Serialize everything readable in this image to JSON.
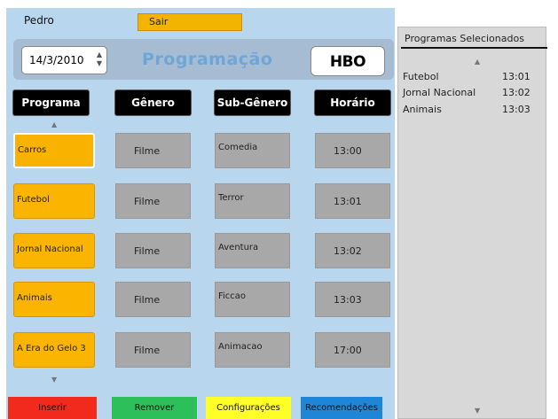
{
  "user": {
    "name": "Pedro",
    "logout_label": "Sair"
  },
  "date": {
    "value": "14/3/2010",
    "spinner_up": "▲",
    "spinner_down": "▼"
  },
  "title": "Programação",
  "channel_logo": "HBO",
  "columns": [
    "Programa",
    "Gênero",
    "Sub-Gênero",
    "Horário"
  ],
  "arrows": {
    "up": "▲",
    "down": "▼"
  },
  "programs": [
    {
      "name": "Carros",
      "genre": "Filme",
      "subgenre": "Comedia",
      "time": "13:00",
      "selected": true
    },
    {
      "name": "Futebol",
      "genre": "Filme",
      "subgenre": "Terror",
      "time": "13:01",
      "selected": false
    },
    {
      "name": "Jornal Nacional",
      "genre": "Filme",
      "subgenre": "Aventura",
      "time": "13:02",
      "selected": false
    },
    {
      "name": "Animais",
      "genre": "Filme",
      "subgenre": "Ficcao",
      "time": "13:03",
      "selected": false
    },
    {
      "name": "A Era do Gelo 3",
      "genre": "Filme",
      "subgenre": "Animacao",
      "time": "17:00",
      "selected": false
    }
  ],
  "actions": [
    {
      "label": "Inserir",
      "color": "#f22a1e"
    },
    {
      "label": "Remover",
      "color": "#2dbf5a"
    },
    {
      "label": "Configurações",
      "color": "#ffff28"
    },
    {
      "label": "Recomendações",
      "color": "#1f85d6"
    }
  ],
  "selected_panel": {
    "title": "Programas Selecionados",
    "items": [
      {
        "name": "Futebol",
        "time": "13:01"
      },
      {
        "name": "Jornal Nacional",
        "time": "13:02"
      },
      {
        "name": "Animais",
        "time": "13:03"
      }
    ]
  },
  "colors": {
    "panel_bg": "#b8d6ee",
    "program_button": "#fbb400",
    "cell": "#a8a8a8",
    "header": "#000000",
    "title": "#6fa6d8"
  }
}
